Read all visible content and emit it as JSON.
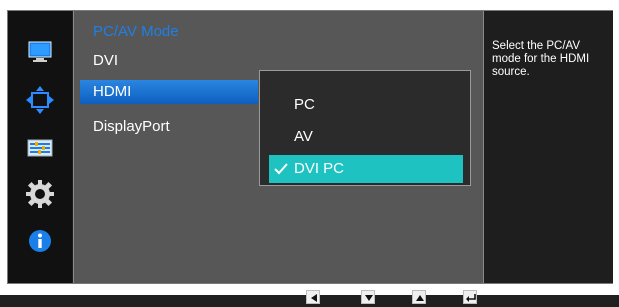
{
  "menu": {
    "title": "PC/AV Mode",
    "items": [
      {
        "label": "DVI"
      },
      {
        "label": "HDMI"
      },
      {
        "label": "DisplayPort"
      }
    ]
  },
  "popup": {
    "options": [
      {
        "label": "PC"
      },
      {
        "label": "AV"
      },
      {
        "label": "DVI PC"
      }
    ]
  },
  "help": {
    "text": "Select the PC/AV mode for the HDMI source."
  },
  "sidebar": {
    "icons": [
      "monitor-icon",
      "arrows-icon",
      "sliders-icon",
      "gear-icon",
      "info-icon"
    ]
  },
  "nav": {
    "buttons": [
      "left-arrow-icon",
      "down-arrow-icon",
      "up-arrow-icon",
      "enter-icon"
    ]
  },
  "colors": {
    "accent_blue": "#1e7fe6",
    "selected_teal": "#1ec2c1"
  }
}
